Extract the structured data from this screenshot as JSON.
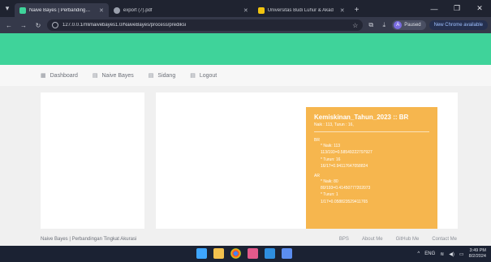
{
  "browser": {
    "tabs": [
      {
        "title": "Naive Bayes | Perbandingan Ti",
        "active": true,
        "fav_color": "#3fd39a"
      },
      {
        "title": "export (7).pdf",
        "active": false,
        "fav_color": "#9aa0ad"
      },
      {
        "title": "Universitas Budi Luhur & Akad",
        "active": false,
        "fav_color": "#f1c40f"
      }
    ],
    "new_tab": "+",
    "url": "127.0.0.1/ml/naivebayes1.0/NaiveBayes/process/prediksi",
    "profile_initial": "A",
    "profile_name": "Paused",
    "update_label": "New Chrome available"
  },
  "nav": {
    "items": [
      {
        "label": "Dashboard",
        "icon": "grid-icon"
      },
      {
        "label": "Naive Bayes",
        "icon": "table-icon"
      },
      {
        "label": "Sidang",
        "icon": "table-icon"
      },
      {
        "label": "Logout",
        "icon": "table-icon"
      }
    ]
  },
  "card": {
    "title": "Kemiskinan_Tahun_2023 :: BR",
    "subtitle": "Naik : 113, Turun : 16,",
    "groups": [
      {
        "label": "BR",
        "lines": [
          "* Naik: 113",
          "113/193=0.58549222797927",
          "* Turun: 16",
          "16/17=0.94117647058824"
        ]
      },
      {
        "label": "AR",
        "lines": [
          "* Naik: 80",
          "80/193=0.41450777202073",
          "* Turun: 1",
          "1/17=0.058823529411765"
        ]
      }
    ]
  },
  "footer": {
    "brand": "Naive Bayes | Perbandingan Tingkat Akurasi",
    "links": [
      "BPS",
      "About Me",
      "GitHub Me",
      "Contact Me"
    ]
  },
  "taskbar": {
    "lang": "ENG",
    "time": "3:49 PM",
    "date": "8/2/2024"
  }
}
